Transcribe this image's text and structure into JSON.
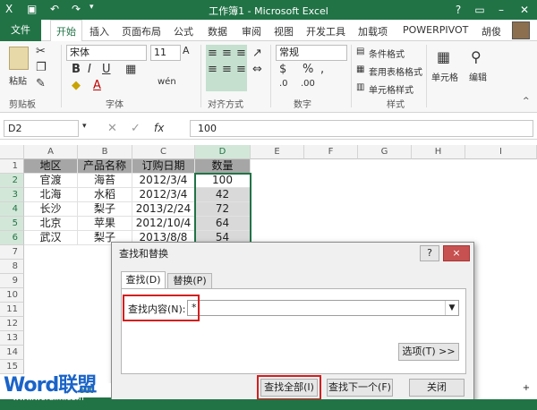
{
  "app": {
    "title": "工作簿1 - Microsoft Excel",
    "user": "胡俊"
  },
  "tabs": [
    "文件",
    "开始",
    "插入",
    "页面布局",
    "公式",
    "数据",
    "审阅",
    "视图",
    "开发工具",
    "加载项",
    "POWERPIVOT"
  ],
  "ribbon": {
    "clipboard": {
      "paste": "粘贴",
      "label": "剪贴板"
    },
    "font": {
      "name": "宋体",
      "size": "11",
      "label": "字体",
      "bold": "B",
      "italic": "I",
      "underline": "U",
      "phonetic": "wén"
    },
    "alignment": {
      "label": "对齐方式"
    },
    "number": {
      "format": "常规",
      "label": "数字",
      "currency": "$",
      "percent": "%",
      "comma": ","
    },
    "styles": {
      "conditional": "条件格式",
      "table": "套用表格格式",
      "cell": "单元格样式",
      "label": "样式"
    },
    "cells": {
      "label": "单元格"
    },
    "editing": {
      "label": "编辑"
    }
  },
  "formula_bar": {
    "name_box": "D2",
    "value": "100",
    "fx": "fx"
  },
  "sheet": {
    "columns": [
      "A",
      "B",
      "C",
      "D",
      "E",
      "F",
      "G",
      "H",
      "I"
    ],
    "rows": [
      "1",
      "2",
      "3",
      "4",
      "5",
      "6",
      "7",
      "8",
      "9",
      "10",
      "11",
      "12",
      "13",
      "14",
      "15"
    ],
    "header": [
      "地区",
      "产品名称",
      "订购日期",
      "数量"
    ],
    "data": [
      [
        "官渡",
        "海苔",
        "2012/3/4",
        "100"
      ],
      [
        "北海",
        "水稻",
        "2012/3/4",
        "42"
      ],
      [
        "长沙",
        "梨子",
        "2013/2/24",
        "72"
      ],
      [
        "北京",
        "苹果",
        "2012/10/4",
        "64"
      ],
      [
        "武汉",
        "梨子",
        "2013/8/8",
        "54"
      ]
    ],
    "sheet_tab_partial": "eet"
  },
  "dialog": {
    "title": "查找和替换",
    "help": "?",
    "close": "×",
    "tab_find": "查找(D)",
    "tab_replace": "替换(P)",
    "find_label": "查找内容(N):",
    "find_value": "*",
    "options": "选项(T) >>",
    "find_all": "查找全部(I)",
    "find_next": "查找下一个(F)",
    "close_btn": "关闭"
  },
  "watermark": {
    "text": "Word联盟",
    "url": "www.wordlm.com"
  },
  "colors": {
    "accent": "#217346",
    "highlight": "#d21f1f"
  }
}
